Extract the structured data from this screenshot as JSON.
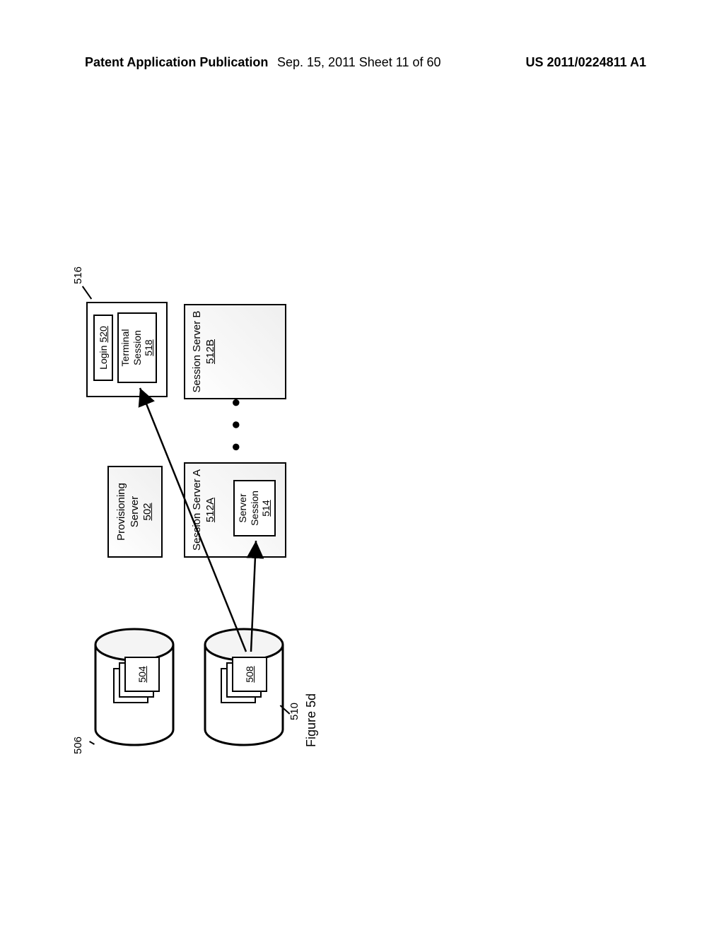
{
  "header": {
    "left": "Patent Application Publication",
    "center": "Sep. 15, 2011  Sheet 11 of 60",
    "right": "US 2011/0224811 A1"
  },
  "figure_caption": "Figure 5d",
  "refs": {
    "provisioning_server": {
      "label": "Provisioning Server",
      "num": "502"
    },
    "cyl1": "506",
    "stack1": "504",
    "cyl2": "510",
    "stack2": "508",
    "session_server_a": {
      "label": "Session Server A",
      "num": "512A"
    },
    "server_session": {
      "label": "Server Session",
      "num": "514"
    },
    "session_server_b": {
      "label": "Session Server B",
      "num": "512B"
    },
    "terminal": "516",
    "login": {
      "label": "Login",
      "num": "520"
    },
    "terminal_session": {
      "label": "Terminal Session",
      "num": "518"
    },
    "ellipsis": "● ● ●"
  }
}
